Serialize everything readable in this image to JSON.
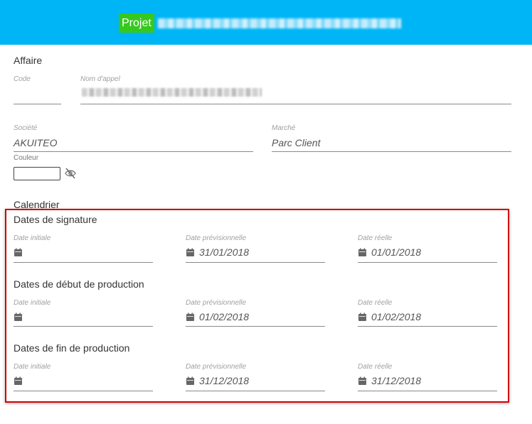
{
  "header": {
    "badge": "Projet",
    "background_color": "#00b5f5",
    "badge_color": "#36c81f"
  },
  "affaire": {
    "title": "Affaire",
    "code_label": "Code",
    "code_value": "",
    "nom_label": "Nom d'appel",
    "societe_label": "Société",
    "societe_value": "AKUITEO",
    "marche_label": "Marché",
    "marche_value": "Parc Client",
    "couleur_label": "Couleur"
  },
  "calendrier": {
    "title": "Calendrier",
    "highlight_color": "#d40000",
    "groups": [
      {
        "title": "Dates de signature",
        "initiale_label": "Date initiale",
        "initiale_value": "",
        "previsionnelle_label": "Date prévisionnelle",
        "previsionnelle_value": "31/01/2018",
        "reelle_label": "Date réelle",
        "reelle_value": "01/01/2018"
      },
      {
        "title": "Dates de début de production",
        "initiale_label": "Date initiale",
        "initiale_value": "",
        "previsionnelle_label": "Date prévisionnelle",
        "previsionnelle_value": "01/02/2018",
        "reelle_label": "Date réelle",
        "reelle_value": "01/02/2018"
      },
      {
        "title": "Dates de fin de production",
        "initiale_label": "Date initiale",
        "initiale_value": "",
        "previsionnelle_label": "Date prévisionnelle",
        "previsionnelle_value": "31/12/2018",
        "reelle_label": "Date réelle",
        "reelle_value": "31/12/2018"
      }
    ]
  },
  "icons": {
    "calendar": "calendar-icon",
    "visibility_off": "eye-slash-icon"
  }
}
